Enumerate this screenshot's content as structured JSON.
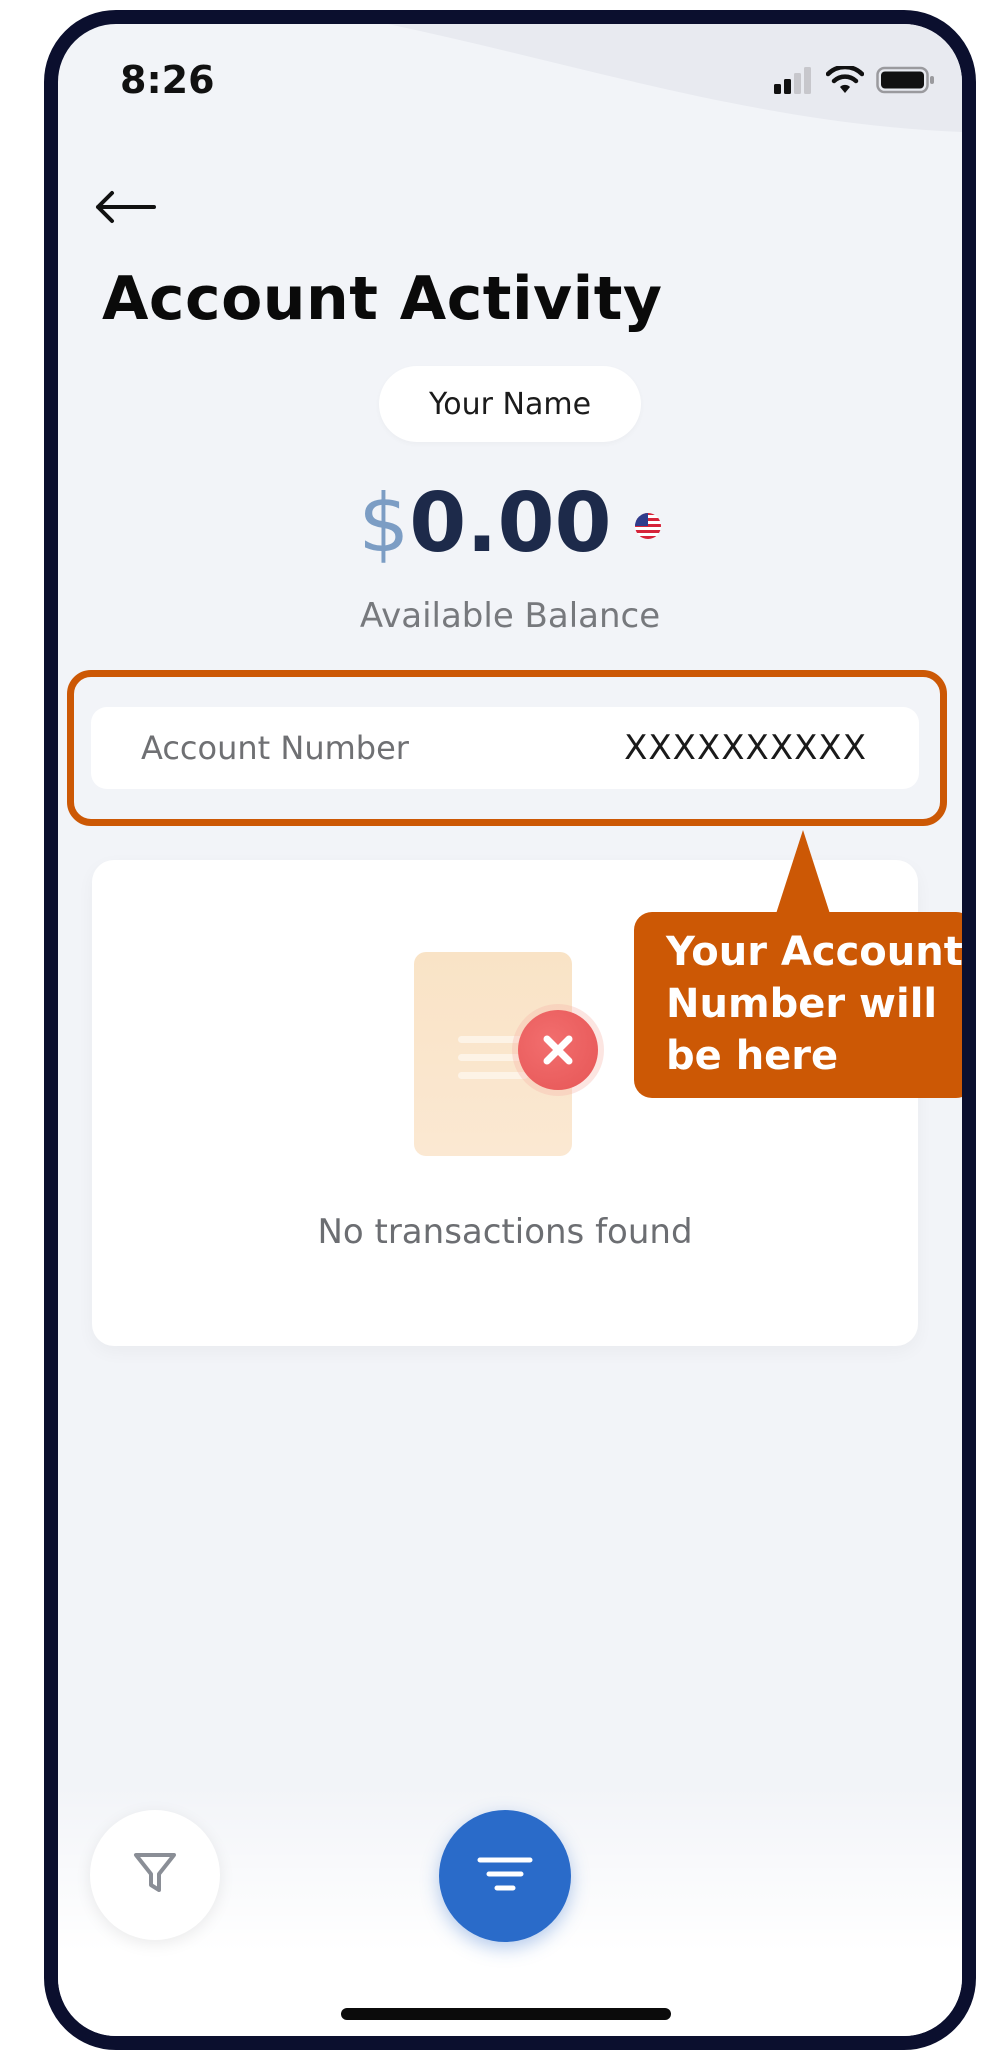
{
  "status_bar": {
    "time": "8:26",
    "signal_icon": "cellular-signal-icon",
    "wifi_icon": "wifi-icon",
    "battery_icon": "battery-icon"
  },
  "header": {
    "back_icon": "arrow-left-icon",
    "title": "Account Activity"
  },
  "account": {
    "holder_name": "Your Name",
    "currency_symbol": "$",
    "balance": "0.00",
    "flag_icon": "us-flag-icon",
    "balance_label": "Available Balance",
    "number_label": "Account Number",
    "number_value": "XXXXXXXXXX"
  },
  "transactions": {
    "empty_icon": "no-transactions-document-icon",
    "empty_message": "No transactions found"
  },
  "callout": {
    "text": "Your Account Number will be here",
    "color": "#CC5805"
  },
  "bottom_bar": {
    "filter_icon": "filter-funnel-icon",
    "menu_icon": "menu-lines-icon",
    "accent_color": "#2A6BC9"
  }
}
